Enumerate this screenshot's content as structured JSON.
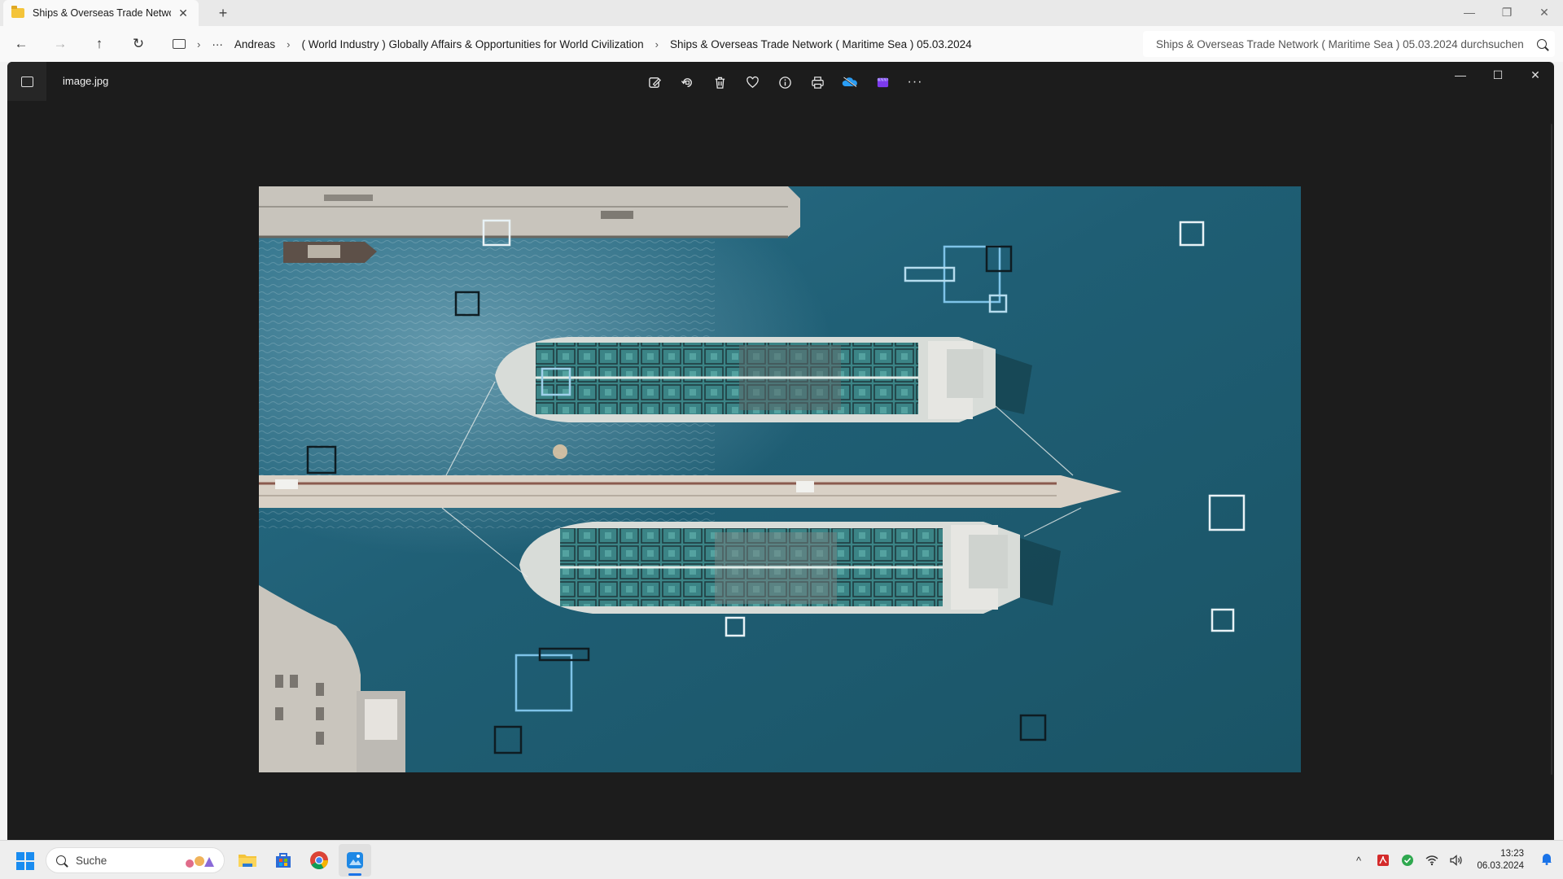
{
  "explorer": {
    "tab_title": "Ships & Overseas Trade Network ( Maritime Sea ) 05.03.2024",
    "tab_close": "✕",
    "new_tab": "+",
    "nav": {
      "back": "←",
      "forward": "→",
      "up": "↑",
      "refresh": "↻"
    },
    "breadcrumb": {
      "more": "···",
      "items": [
        "Andreas",
        "( World Industry ) Globally Affairs & Opportunities for World Civilization",
        "Ships & Overseas Trade Network ( Maritime Sea ) 05.03.2024"
      ],
      "separator": "›"
    },
    "search_placeholder": "Ships & Overseas Trade Network ( Maritime Sea ) 05.03.2024 durchsuchen",
    "window_controls": {
      "minimize": "—",
      "restore": "❐",
      "close": "✕"
    }
  },
  "photos": {
    "file_name": "image.jpg",
    "toolbar_icons": [
      "edit-icon",
      "rotate-icon",
      "delete-icon",
      "favorite-icon",
      "info-icon",
      "print-icon",
      "onedrive-icon",
      "clipchamp-icon",
      "more-icon"
    ],
    "more_label": "···",
    "window_controls": {
      "minimize": "—",
      "maximize": "☐",
      "close": "✕"
    }
  },
  "taskbar": {
    "search_label": "Suche",
    "apps": [
      "file-explorer-icon",
      "store-icon",
      "chrome-icon",
      "photos-icon"
    ],
    "tray": {
      "chevron": "^",
      "time": "13:23",
      "date": "06.03.2024"
    }
  },
  "colors": {
    "accent": "#1a73e8",
    "viewer_bg": "#1c1c1c",
    "water": "#1f5a6e",
    "ship_deck": "#3f8a8c",
    "frame_light": "#7ec3e8"
  }
}
